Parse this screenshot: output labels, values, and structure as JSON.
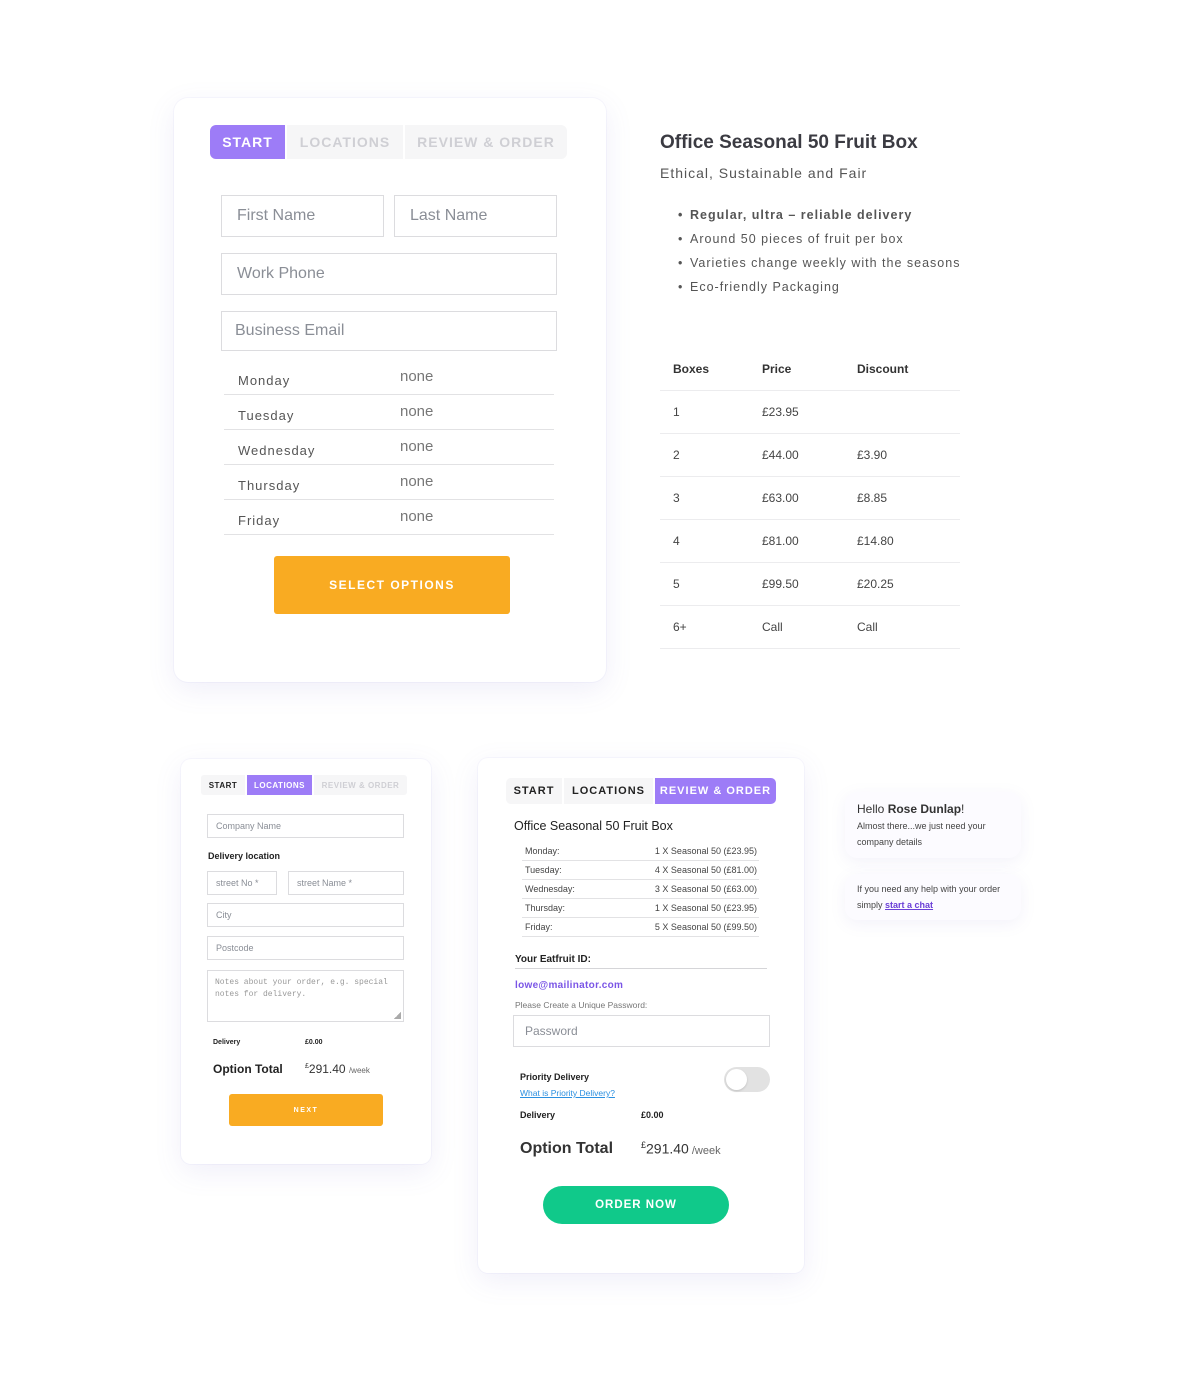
{
  "start_card": {
    "tabs": [
      {
        "label": "START",
        "active": true
      },
      {
        "label": "LOCATIONS",
        "active": false
      },
      {
        "label": "REVIEW & ORDER",
        "active": false
      }
    ],
    "first_name_placeholder": "First Name",
    "last_name_placeholder": "Last Name",
    "work_phone_placeholder": "Work Phone",
    "business_email_placeholder": "Business Email",
    "days": [
      {
        "day": "Monday",
        "value": "none"
      },
      {
        "day": "Tuesday",
        "value": "none"
      },
      {
        "day": "Wednesday",
        "value": "none"
      },
      {
        "day": "Thursday",
        "value": "none"
      },
      {
        "day": "Friday",
        "value": "none"
      }
    ],
    "select_button": "SELECT OPTIONS"
  },
  "product": {
    "title": "Office Seasonal 50 Fruit Box",
    "subtitle": "Ethical, Sustainable and Fair",
    "features": [
      "Regular, ultra – reliable delivery",
      "Around 50 pieces of fruit per box",
      "Varieties change weekly with the seasons",
      "Eco-friendly Packaging"
    ],
    "price_table": {
      "headers": [
        "Boxes",
        "Price",
        "Discount"
      ],
      "rows": [
        [
          "1",
          "£23.95",
          ""
        ],
        [
          "2",
          "£44.00",
          "£3.90"
        ],
        [
          "3",
          "£63.00",
          "£8.85"
        ],
        [
          "4",
          "£81.00",
          "£14.80"
        ],
        [
          "5",
          "£99.50",
          "£20.25"
        ],
        [
          "6+",
          "Call",
          "Call"
        ]
      ]
    }
  },
  "locations_card": {
    "tabs": [
      {
        "label": "START",
        "active": false
      },
      {
        "label": "LOCATIONS",
        "active": true
      },
      {
        "label": "REVIEW & ORDER",
        "active": false
      }
    ],
    "company_placeholder": "Company Name",
    "delivery_location_label": "Delivery location",
    "street_no_placeholder": "street No *",
    "street_name_placeholder": "street Name *",
    "city_placeholder": "City",
    "postcode_placeholder": "Postcode",
    "notes_placeholder": "Notes about your order, e.g. special notes for delivery.",
    "delivery_label": "Delivery",
    "delivery_value": "£0.00",
    "option_total_label": "Option Total",
    "currency": "£",
    "option_total_value": "291.40",
    "per_week": "/week",
    "next_button": "NEXT"
  },
  "review_card": {
    "tabs": [
      {
        "label": "START",
        "active": false
      },
      {
        "label": "LOCATIONS",
        "active": false
      },
      {
        "label": "REVIEW & ORDER",
        "active": true
      }
    ],
    "title": "Office Seasonal 50 Fruit Box",
    "schedule": [
      {
        "day": "Monday:",
        "value": "1 X Seasonal 50 (£23.95)"
      },
      {
        "day": "Tuesday:",
        "value": "4 X Seasonal 50 (£81.00)"
      },
      {
        "day": "Wednesday:",
        "value": "3 X Seasonal 50 (£63.00)"
      },
      {
        "day": "Thursday:",
        "value": "1 X Seasonal 50 (£23.95)"
      },
      {
        "day": "Friday:",
        "value": "5 X Seasonal 50 (£99.50)"
      }
    ],
    "id_label": "Your Eatfruit ID:",
    "email": "lowe@mailinator.com",
    "password_label": "Please Create a Unique Password:",
    "password_placeholder": "Password",
    "priority_label": "Priority Delivery",
    "priority_link": "What is Priority Delivery?",
    "priority_on": false,
    "delivery_label": "Delivery",
    "delivery_value": "£0.00",
    "option_total_label": "Option Total",
    "currency": "£",
    "option_total_value": "291.40",
    "per_week": "/week",
    "order_button": "ORDER NOW"
  },
  "chat": {
    "hello_prefix": "Hello ",
    "user_name": "Rose Dunlap",
    "hello_suffix": "!",
    "message1": "Almost there...we just need your company details",
    "message2_prefix": "If you need any help with your order simply ",
    "chat_link": "start a chat"
  },
  "colors": {
    "accent_purple": "#9d7cf7",
    "orange": "#f9ab22",
    "green": "#10c98a",
    "link_blue": "#2a8fe0"
  }
}
